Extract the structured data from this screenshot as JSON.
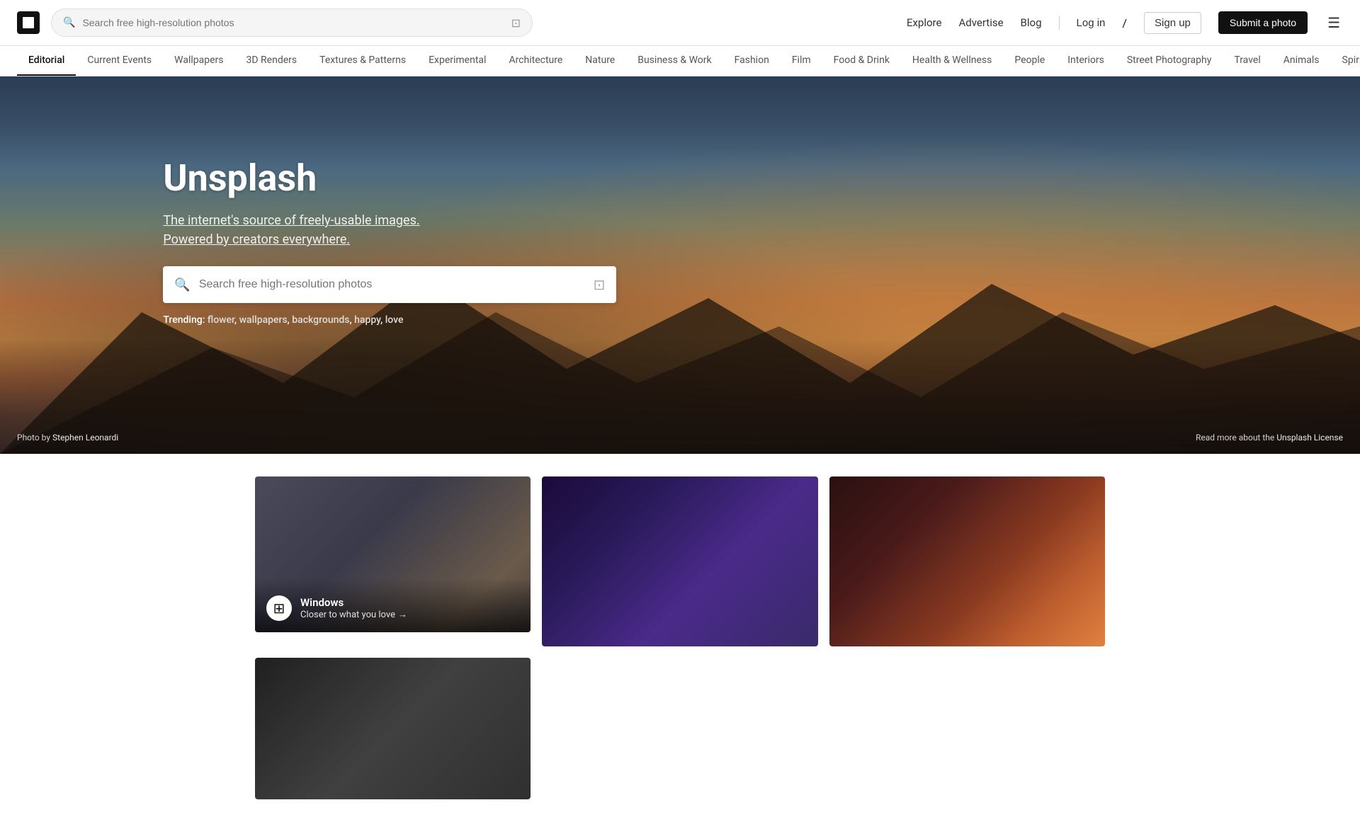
{
  "header": {
    "logo_alt": "Unsplash logo",
    "search_placeholder": "Search free high-resolution photos",
    "nav": {
      "explore": "Explore",
      "advertise": "Advertise",
      "blog": "Blog",
      "login": "Log in",
      "divider": "/",
      "signup": "Sign up",
      "submit": "Submit a photo"
    }
  },
  "categories": [
    {
      "id": "editorial",
      "label": "Editorial",
      "active": true
    },
    {
      "id": "current-events",
      "label": "Current Events",
      "active": false
    },
    {
      "id": "wallpapers",
      "label": "Wallpapers",
      "active": false
    },
    {
      "id": "3d-renders",
      "label": "3D Renders",
      "active": false
    },
    {
      "id": "textures-patterns",
      "label": "Textures & Patterns",
      "active": false
    },
    {
      "id": "experimental",
      "label": "Experimental",
      "active": false
    },
    {
      "id": "architecture",
      "label": "Architecture",
      "active": false
    },
    {
      "id": "nature",
      "label": "Nature",
      "active": false
    },
    {
      "id": "business-work",
      "label": "Business & Work",
      "active": false
    },
    {
      "id": "fashion",
      "label": "Fashion",
      "active": false
    },
    {
      "id": "film",
      "label": "Film",
      "active": false
    },
    {
      "id": "food-drink",
      "label": "Food & Drink",
      "active": false
    },
    {
      "id": "health-wellness",
      "label": "Health & Wellness",
      "active": false
    },
    {
      "id": "people",
      "label": "People",
      "active": false
    },
    {
      "id": "interiors",
      "label": "Interiors",
      "active": false
    },
    {
      "id": "street-photography",
      "label": "Street Photography",
      "active": false
    },
    {
      "id": "travel",
      "label": "Travel",
      "active": false
    },
    {
      "id": "animals",
      "label": "Animals",
      "active": false
    },
    {
      "id": "spirituality",
      "label": "Spirituality",
      "active": false
    }
  ],
  "hero": {
    "title": "Unsplash",
    "subtitle_plain": "The internet's source of ",
    "subtitle_link": "freely-usable images.",
    "subtitle_end": "Powered by creators everywhere.",
    "search_placeholder": "Search free high-resolution photos",
    "trending_label": "Trending:",
    "trending_items": [
      "flower",
      "wallpapers",
      "backgrounds",
      "happy",
      "love"
    ],
    "photo_credit_prefix": "Photo",
    "photo_credit_by": "by",
    "photographer_name": "Stephen Leonardi",
    "license_text": "Read more about the",
    "license_link": "Unsplash License"
  },
  "photos": [
    {
      "id": "card-1",
      "type": "ad",
      "ad_brand": "Windows",
      "ad_tagline": "Closer to what you love",
      "ad_arrow": "→"
    },
    {
      "id": "card-2",
      "type": "photo"
    },
    {
      "id": "card-3",
      "type": "photo"
    },
    {
      "id": "card-4",
      "type": "photo"
    }
  ]
}
